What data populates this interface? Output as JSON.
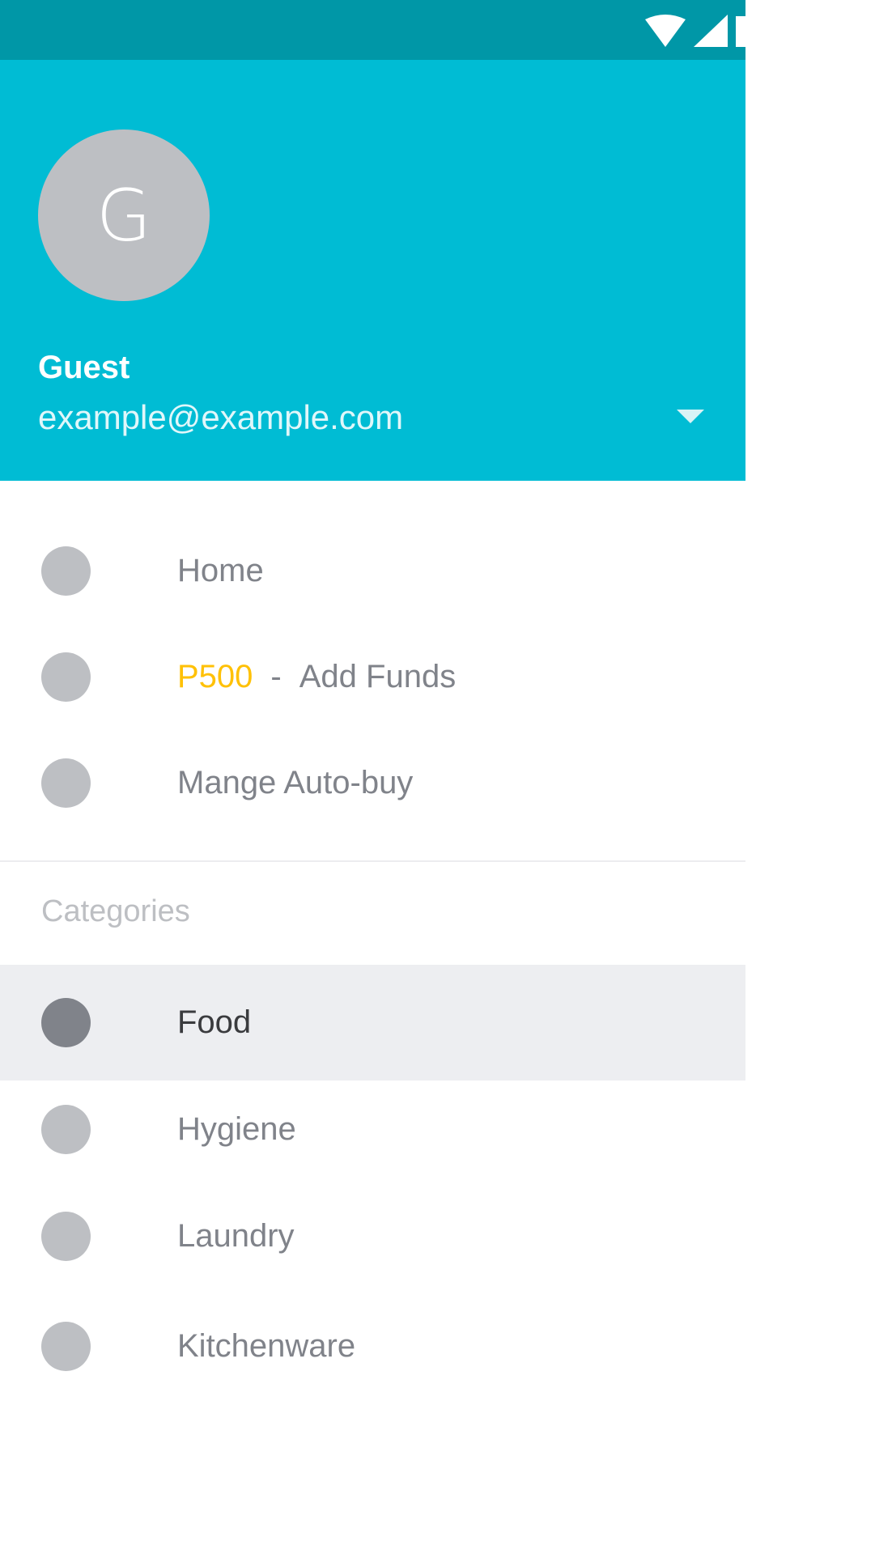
{
  "status_bar": {
    "icons": [
      "wifi-icon",
      "cellular-signal-icon",
      "battery-icon"
    ],
    "color": "#0097a7"
  },
  "header": {
    "avatar_letter": "G",
    "name": "Guest",
    "email": "example@example.com",
    "color": "#00bcd4"
  },
  "nav": {
    "home": "Home",
    "funds_amount": "P500",
    "funds_separator": "-",
    "funds_label": "Add Funds",
    "auto_buy": "Mange Auto-buy"
  },
  "categories": {
    "title": "Categories",
    "items": [
      {
        "label": "Food",
        "selected": true
      },
      {
        "label": "Hygiene",
        "selected": false
      },
      {
        "label": "Laundry",
        "selected": false
      },
      {
        "label": "Kitchenware",
        "selected": false
      }
    ]
  },
  "colors": {
    "accent_amount": "#ffc107",
    "selected_background": "#edeef1"
  }
}
